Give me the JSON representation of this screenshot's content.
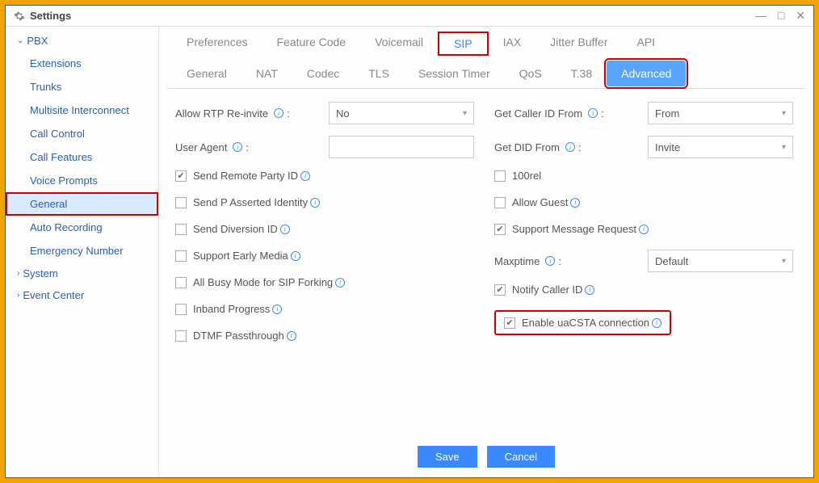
{
  "window": {
    "title": "Settings"
  },
  "sidebar": {
    "groups": [
      {
        "label": "PBX",
        "expanded": true,
        "items": [
          {
            "label": "Extensions"
          },
          {
            "label": "Trunks"
          },
          {
            "label": "Multisite Interconnect"
          },
          {
            "label": "Call Control"
          },
          {
            "label": "Call Features"
          },
          {
            "label": "Voice Prompts"
          },
          {
            "label": "General",
            "active": true,
            "highlight": true
          },
          {
            "label": "Auto Recording"
          },
          {
            "label": "Emergency Number"
          }
        ]
      },
      {
        "label": "System",
        "expanded": false,
        "items": []
      },
      {
        "label": "Event Center",
        "expanded": false,
        "items": []
      }
    ]
  },
  "tabs": [
    {
      "label": "Preferences"
    },
    {
      "label": "Feature Code"
    },
    {
      "label": "Voicemail"
    },
    {
      "label": "SIP",
      "active": true,
      "highlight": true
    },
    {
      "label": "IAX"
    },
    {
      "label": "Jitter Buffer"
    },
    {
      "label": "API"
    }
  ],
  "subtabs": [
    {
      "label": "General"
    },
    {
      "label": "NAT"
    },
    {
      "label": "Codec"
    },
    {
      "label": "TLS"
    },
    {
      "label": "Session Timer"
    },
    {
      "label": "QoS"
    },
    {
      "label": "T.38"
    },
    {
      "label": "Advanced",
      "active": true,
      "highlight": true
    }
  ],
  "form": {
    "allow_rtp_reinvite": {
      "label": "Allow RTP Re-invite",
      "value": "No"
    },
    "user_agent": {
      "label": "User Agent",
      "value": ""
    },
    "send_remote_party_id": {
      "label": "Send Remote Party ID",
      "checked": true
    },
    "send_p_asserted": {
      "label": "Send P Asserted Identity",
      "checked": false
    },
    "send_diversion": {
      "label": "Send Diversion ID",
      "checked": false
    },
    "support_early_media": {
      "label": "Support Early Media",
      "checked": false
    },
    "all_busy_mode": {
      "label": "All Busy Mode for SIP Forking",
      "checked": false
    },
    "inband_progress": {
      "label": "Inband Progress",
      "checked": false
    },
    "dtmf_passthrough": {
      "label": "DTMF Passthrough",
      "checked": false
    },
    "get_caller_id": {
      "label": "Get Caller ID From",
      "value": "From"
    },
    "get_did": {
      "label": "Get DID From",
      "value": "Invite"
    },
    "rel100": {
      "label": "100rel",
      "checked": false
    },
    "allow_guest": {
      "label": "Allow Guest",
      "checked": false
    },
    "support_message_req": {
      "label": "Support Message Request",
      "checked": true
    },
    "maxptime": {
      "label": "Maxptime",
      "value": "Default"
    },
    "notify_caller_id": {
      "label": "Notify Caller ID",
      "checked": true
    },
    "enable_uacsta": {
      "label": "Enable uaCSTA connection",
      "checked": true,
      "highlight": true
    }
  },
  "buttons": {
    "save": "Save",
    "cancel": "Cancel"
  }
}
